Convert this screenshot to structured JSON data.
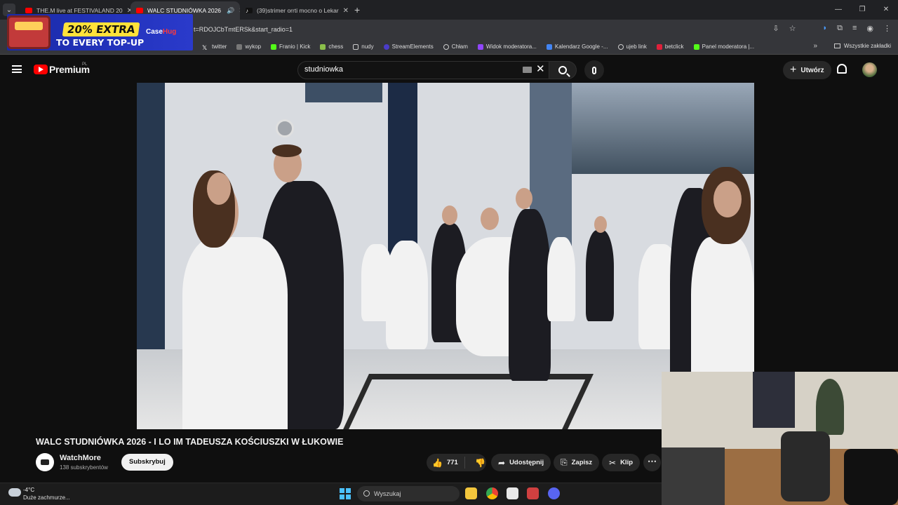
{
  "browser": {
    "tabs": [
      {
        "title": "THE.M live at FESTIVALAND 20",
        "active": false
      },
      {
        "title": "WALC STUDNIÓWKA 2026",
        "active": true
      },
      {
        "title": "(39)strimer orrti mocno o Lekar",
        "active": false
      }
    ],
    "url": "t=RDOJCbTmtERSk&start_radio=1",
    "bookmarks": [
      "twitter",
      "wykop",
      "Franio | Kick",
      "chess",
      "nudy",
      "StreamElements",
      "Chłam",
      "Widok moderatora...",
      "Kalendarz Google -...",
      "ujeb link",
      "betclick",
      "Panel moderatora |..."
    ],
    "all_bookmarks": "Wszystkie zakładki"
  },
  "ad": {
    "line1": "20% EXTRA",
    "line2": "TO EVERY TOP-UP",
    "brand_a": "Case",
    "brand_b": "Hug"
  },
  "youtube": {
    "brand": "Premium",
    "region": "PL",
    "search_query": "studniowka",
    "create_label": "Utwórz"
  },
  "video": {
    "title": "WALC STUDNIÓWKA 2026 - I LO IM TADEUSZA KOŚCIUSZKI W ŁUKOWIE",
    "channel": "WatchMore",
    "subscribers": "138 subskrybentów",
    "subscribe_label": "Subskrybuj",
    "likes": "771",
    "share_label": "Udostępnij",
    "save_label": "Zapisz",
    "clip_label": "Klip"
  },
  "taskbar": {
    "temperature": "-4°C",
    "weather": "Duże zachmurze...",
    "search_placeholder": "Wyszukaj"
  }
}
